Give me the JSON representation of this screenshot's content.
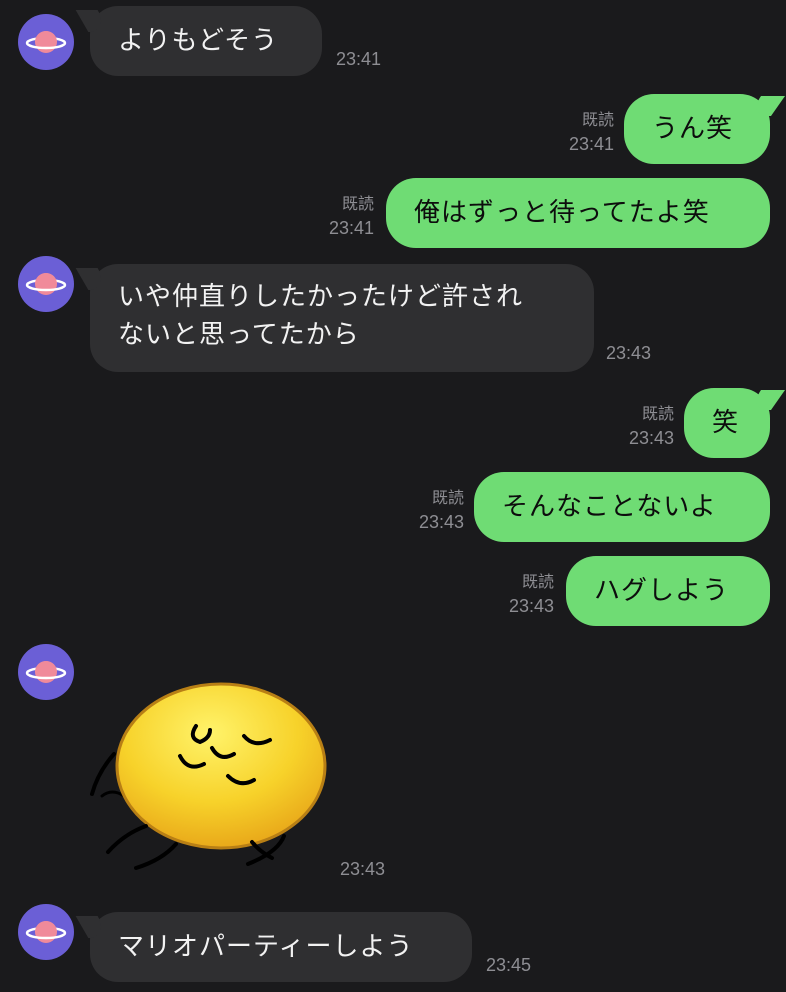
{
  "messages": [
    {
      "side": "in",
      "text": "よりもどそう",
      "time": "23:41"
    },
    {
      "side": "out",
      "text": "うん笑",
      "read": "既読",
      "time": "23:41"
    },
    {
      "side": "out",
      "text": "俺はずっと待ってたよ笑",
      "read": "既読",
      "time": "23:41"
    },
    {
      "side": "in",
      "line1": "いや仲直りしたかったけど許され",
      "line2": "ないと思ってたから",
      "time": "23:43"
    },
    {
      "side": "out",
      "text": "笑",
      "read": "既読",
      "time": "23:43"
    },
    {
      "side": "out",
      "text": "そんなことないよ",
      "read": "既読",
      "time": "23:43"
    },
    {
      "side": "out",
      "text": "ハグしよう",
      "read": "既読",
      "time": "23:43"
    },
    {
      "side": "in",
      "sticker": "yellow-blob-running-sticker",
      "time": "23:43"
    },
    {
      "side": "in",
      "text": "マリオパーティーしよう",
      "time": "23:45"
    }
  ],
  "colors": {
    "background": "#1a1a1c",
    "incoming_bubble": "#2f2f31",
    "outgoing_bubble": "#6fdc74",
    "avatar": "#6b5fd6",
    "avatar_planet": "#f08a9a",
    "meta_text": "#8e8e93"
  }
}
